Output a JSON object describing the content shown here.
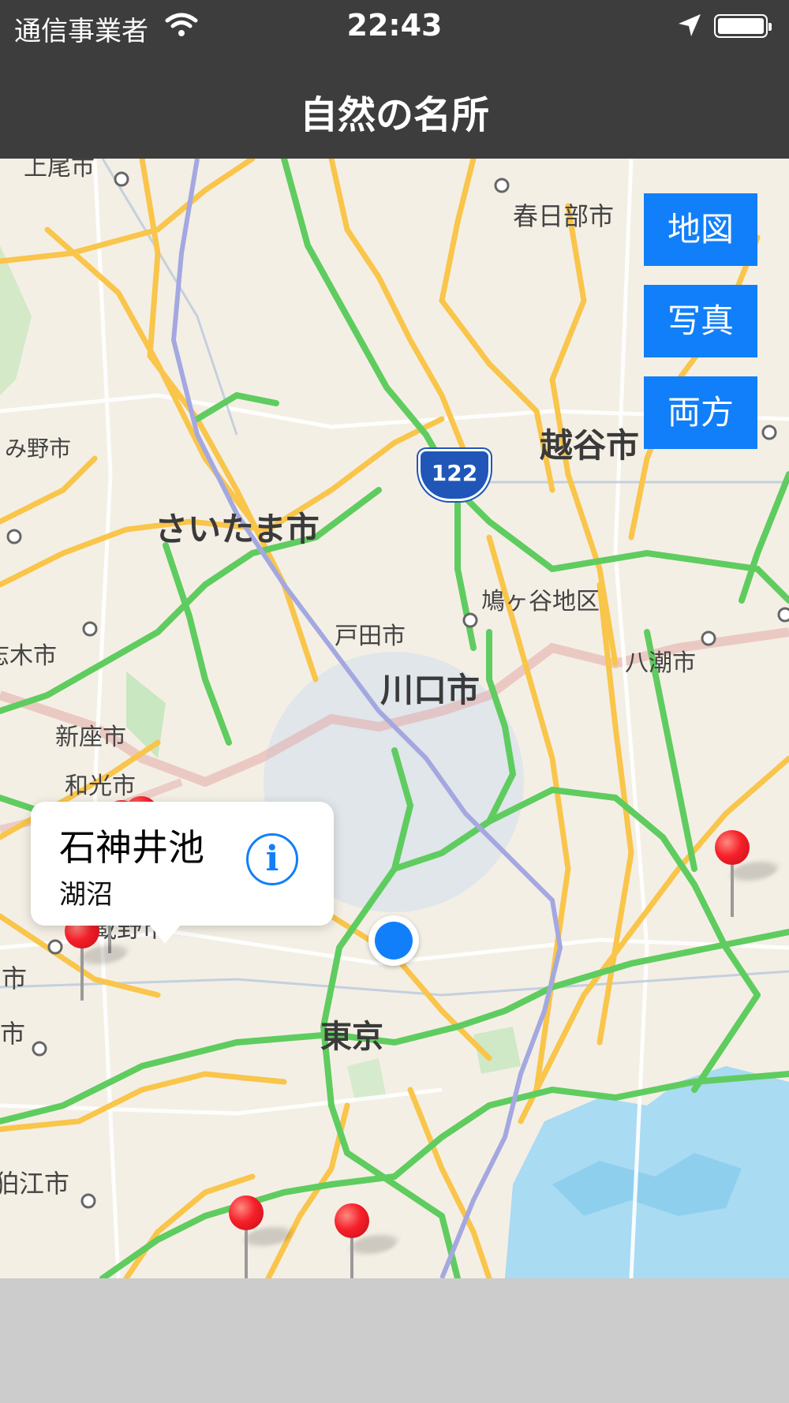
{
  "status_bar": {
    "carrier": "通信事業者",
    "time": "22:43"
  },
  "nav": {
    "title": "自然の名所"
  },
  "map": {
    "labels": [
      "上尾市",
      "春日部市",
      "越谷市",
      "み野市",
      "さいたま市",
      "鳩ヶ谷地区",
      "戸田市",
      "志木市",
      "八潮市",
      "川口市",
      "新座市",
      "和光市",
      "武蔵野市",
      "中市",
      "市",
      "東京",
      "狛江市"
    ],
    "route_shield": "122"
  },
  "map_type_buttons": {
    "map": "地図",
    "photo": "写真",
    "both": "両方"
  },
  "callout": {
    "title": "石神井池",
    "subtitle": "湖沼",
    "info_icon": "i"
  },
  "colors": {
    "accent": "#117ff9",
    "pin": "#f5202a",
    "bar": "#3d3d3d"
  }
}
